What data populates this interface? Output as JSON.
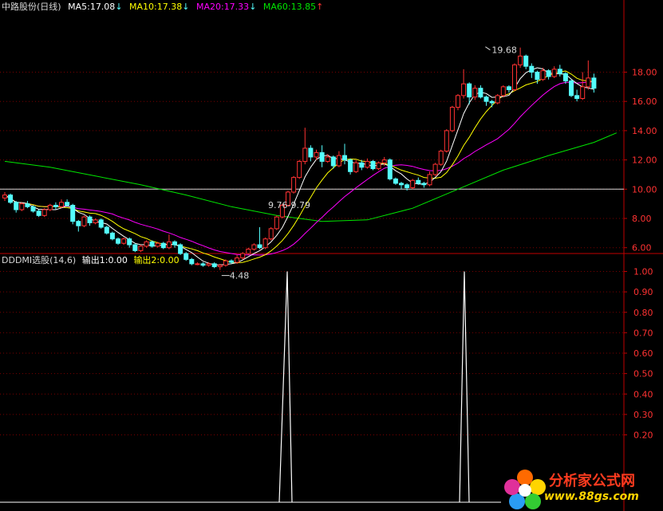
{
  "header": {
    "stock": "中路股份(日线)",
    "ma5": "MA5:17.08",
    "ma10": "MA10:17.38",
    "ma20": "MA20:17.33",
    "ma60": "MA60:13.85",
    "arrow_down": "↓",
    "arrow_up": "↑"
  },
  "indicator": {
    "name": "DDDMI选股(14,6)",
    "out1": "输出1:0.00",
    "out2": "输出2:0.00"
  },
  "watermark": {
    "name": "分析家公式网",
    "url": "www.88gs.com"
  },
  "colors": {
    "up": "#ff3232",
    "down": "#54fcfc",
    "ma5": "#ffffff",
    "ma10": "#ffff00",
    "ma20": "#ff00ff",
    "ma60": "#00e600",
    "axis": "#c00000",
    "grid": "#7a0000"
  },
  "chart_data": [
    {
      "type": "candlestick",
      "y_ticks": [
        "18.00",
        "16.00",
        "14.00",
        "12.00",
        "10.00",
        "8.00",
        "6.00"
      ],
      "ylim": [
        4.0,
        20.0
      ],
      "reference_line": 10.0,
      "annotations": [
        {
          "text": "19.68",
          "at_index": 84,
          "value": 19.68
        },
        {
          "text": "9.76-9.79",
          "at_index": 50,
          "value": 9.79
        },
        {
          "text": "4.48",
          "at_index": 38,
          "value": 4.48
        }
      ],
      "candles": [
        [
          9.4,
          9.6,
          9.8,
          9.2
        ],
        [
          9.6,
          9.1,
          9.7,
          9.0
        ],
        [
          9.1,
          8.6,
          9.2,
          8.4
        ],
        [
          8.6,
          9.0,
          9.1,
          8.5
        ],
        [
          9.0,
          8.8,
          9.2,
          8.7
        ],
        [
          8.8,
          8.5,
          8.9,
          8.4
        ],
        [
          8.5,
          8.2,
          8.6,
          8.1
        ],
        [
          8.2,
          8.6,
          8.7,
          8.1
        ],
        [
          8.6,
          8.9,
          9.0,
          8.5
        ],
        [
          8.9,
          8.8,
          9.1,
          8.6
        ],
        [
          8.8,
          9.1,
          9.3,
          8.7
        ],
        [
          9.1,
          8.9,
          9.3,
          8.8
        ],
        [
          8.9,
          7.8,
          9.0,
          7.6
        ],
        [
          7.8,
          7.5,
          7.9,
          7.1
        ],
        [
          7.5,
          8.1,
          8.2,
          7.4
        ],
        [
          8.1,
          7.7,
          8.2,
          7.5
        ],
        [
          7.7,
          7.9,
          8.0,
          7.6
        ],
        [
          7.9,
          7.4,
          8.0,
          7.3
        ],
        [
          7.4,
          7.0,
          7.5,
          6.9
        ],
        [
          7.0,
          6.6,
          7.1,
          6.5
        ],
        [
          6.6,
          6.3,
          6.7,
          6.2
        ],
        [
          6.3,
          6.6,
          6.7,
          6.2
        ],
        [
          6.6,
          6.2,
          6.7,
          6.0
        ],
        [
          6.2,
          5.8,
          6.3,
          5.7
        ],
        [
          5.8,
          6.1,
          6.2,
          5.7
        ],
        [
          6.1,
          6.4,
          6.5,
          6.0
        ],
        [
          6.4,
          6.1,
          6.5,
          6.0
        ],
        [
          6.1,
          6.3,
          6.4,
          6.0
        ],
        [
          6.3,
          6.0,
          6.4,
          5.9
        ],
        [
          6.0,
          6.4,
          6.9,
          5.9
        ],
        [
          6.4,
          6.2,
          6.5,
          6.0
        ],
        [
          6.2,
          5.6,
          6.3,
          5.5
        ],
        [
          5.6,
          5.2,
          5.7,
          5.1
        ],
        [
          5.2,
          4.9,
          5.3,
          4.8
        ],
        [
          4.9,
          4.9,
          5.0,
          4.8
        ],
        [
          4.9,
          4.8,
          5.0,
          4.7
        ],
        [
          4.8,
          4.9,
          5.0,
          4.7
        ],
        [
          4.9,
          4.7,
          5.0,
          4.6
        ],
        [
          4.7,
          4.8,
          4.9,
          4.48
        ],
        [
          4.8,
          5.1,
          5.2,
          4.7
        ],
        [
          5.1,
          5.0,
          5.2,
          4.9
        ],
        [
          5.0,
          5.3,
          5.5,
          4.9
        ],
        [
          5.3,
          5.6,
          5.7,
          5.2
        ],
        [
          5.6,
          5.9,
          6.0,
          5.5
        ],
        [
          5.9,
          6.2,
          6.3,
          5.8
        ],
        [
          6.2,
          6.0,
          7.4,
          5.9
        ],
        [
          6.0,
          6.6,
          6.7,
          5.9
        ],
        [
          6.6,
          7.3,
          7.4,
          6.5
        ],
        [
          7.3,
          8.1,
          8.2,
          7.2
        ],
        [
          8.1,
          8.9,
          9.0,
          8.0
        ],
        [
          8.9,
          9.8,
          9.9,
          8.8
        ],
        [
          9.8,
          10.8,
          10.9,
          9.7
        ],
        [
          10.8,
          11.9,
          12.0,
          10.7
        ],
        [
          11.9,
          12.8,
          14.2,
          11.7
        ],
        [
          12.8,
          12.2,
          13.0,
          11.9
        ],
        [
          12.2,
          12.5,
          12.7,
          12.0
        ],
        [
          12.5,
          11.9,
          13.0,
          11.5
        ],
        [
          11.9,
          12.2,
          12.4,
          11.8
        ],
        [
          12.2,
          11.6,
          12.3,
          11.4
        ],
        [
          11.6,
          12.3,
          12.6,
          11.5
        ],
        [
          12.3,
          12.0,
          13.1,
          11.7
        ],
        [
          12.0,
          11.2,
          12.1,
          11.0
        ],
        [
          11.2,
          11.8,
          12.0,
          11.1
        ],
        [
          11.8,
          11.5,
          12.0,
          11.3
        ],
        [
          11.5,
          11.9,
          12.1,
          11.4
        ],
        [
          11.9,
          11.4,
          12.0,
          11.3
        ],
        [
          11.4,
          11.8,
          11.9,
          11.3
        ],
        [
          11.8,
          12.0,
          12.2,
          11.6
        ],
        [
          12.0,
          10.7,
          12.1,
          10.6
        ],
        [
          10.7,
          10.4,
          10.8,
          10.3
        ],
        [
          10.4,
          10.3,
          10.5,
          10.0
        ],
        [
          10.3,
          10.1,
          10.4,
          9.9
        ],
        [
          10.1,
          10.6,
          10.7,
          10.0
        ],
        [
          10.6,
          10.4,
          10.8,
          10.3
        ],
        [
          10.4,
          10.3,
          10.5,
          10.1
        ],
        [
          10.3,
          11.0,
          11.2,
          10.2
        ],
        [
          11.0,
          11.7,
          11.8,
          10.9
        ],
        [
          11.7,
          12.6,
          12.7,
          11.6
        ],
        [
          12.6,
          14.0,
          14.1,
          12.5
        ],
        [
          14.0,
          15.6,
          15.7,
          13.9
        ],
        [
          15.6,
          16.4,
          16.5,
          15.4
        ],
        [
          16.4,
          17.2,
          18.2,
          16.2
        ],
        [
          17.2,
          16.3,
          17.3,
          15.8
        ],
        [
          16.3,
          16.9,
          17.1,
          16.1
        ],
        [
          16.9,
          16.3,
          17.1,
          16.2
        ],
        [
          16.3,
          16.0,
          16.4,
          15.7
        ],
        [
          16.0,
          15.9,
          16.1,
          15.6
        ],
        [
          15.9,
          16.4,
          16.5,
          15.8
        ],
        [
          16.4,
          17.0,
          17.1,
          16.3
        ],
        [
          17.0,
          16.8,
          17.1,
          16.6
        ],
        [
          16.8,
          18.5,
          18.6,
          16.7
        ],
        [
          18.5,
          19.1,
          19.68,
          18.3
        ],
        [
          19.1,
          18.4,
          19.2,
          18.2
        ],
        [
          18.4,
          18.0,
          18.6,
          17.6
        ],
        [
          18.0,
          17.5,
          18.1,
          17.2
        ],
        [
          17.5,
          18.1,
          18.3,
          17.4
        ],
        [
          18.1,
          17.7,
          18.2,
          17.5
        ],
        [
          17.7,
          18.2,
          18.4,
          17.6
        ],
        [
          18.2,
          17.9,
          18.5,
          17.7
        ],
        [
          17.9,
          17.4,
          18.0,
          17.2
        ],
        [
          17.4,
          16.4,
          17.5,
          16.3
        ],
        [
          16.4,
          16.2,
          16.8,
          16.0
        ],
        [
          16.2,
          17.0,
          18.0,
          16.1
        ],
        [
          17.0,
          17.6,
          18.8,
          16.8
        ],
        [
          17.6,
          16.9,
          17.9,
          16.6
        ]
      ],
      "ma60": [
        11.9,
        11.5,
        10.9,
        10.3,
        9.6,
        8.8,
        8.2,
        7.8,
        7.9,
        8.7,
        10.0,
        11.3,
        12.3,
        13.2,
        13.85
      ],
      "ma60_at": [
        0,
        8,
        16,
        24,
        32,
        40,
        48,
        56,
        64,
        72,
        80,
        88,
        96,
        104,
        108
      ]
    },
    {
      "type": "line",
      "y_ticks": [
        "1.00",
        "0.90",
        "0.80",
        "0.70",
        "0.60",
        "0.50",
        "0.40",
        "0.30",
        "0.20"
      ],
      "ylim": [
        0.0,
        1.0
      ],
      "spikes": [
        {
          "from": 350,
          "peak": 360,
          "to": 366,
          "value": 1.0
        },
        {
          "from": 576,
          "peak": 582,
          "to": 588,
          "value": 1.0
        }
      ]
    }
  ]
}
